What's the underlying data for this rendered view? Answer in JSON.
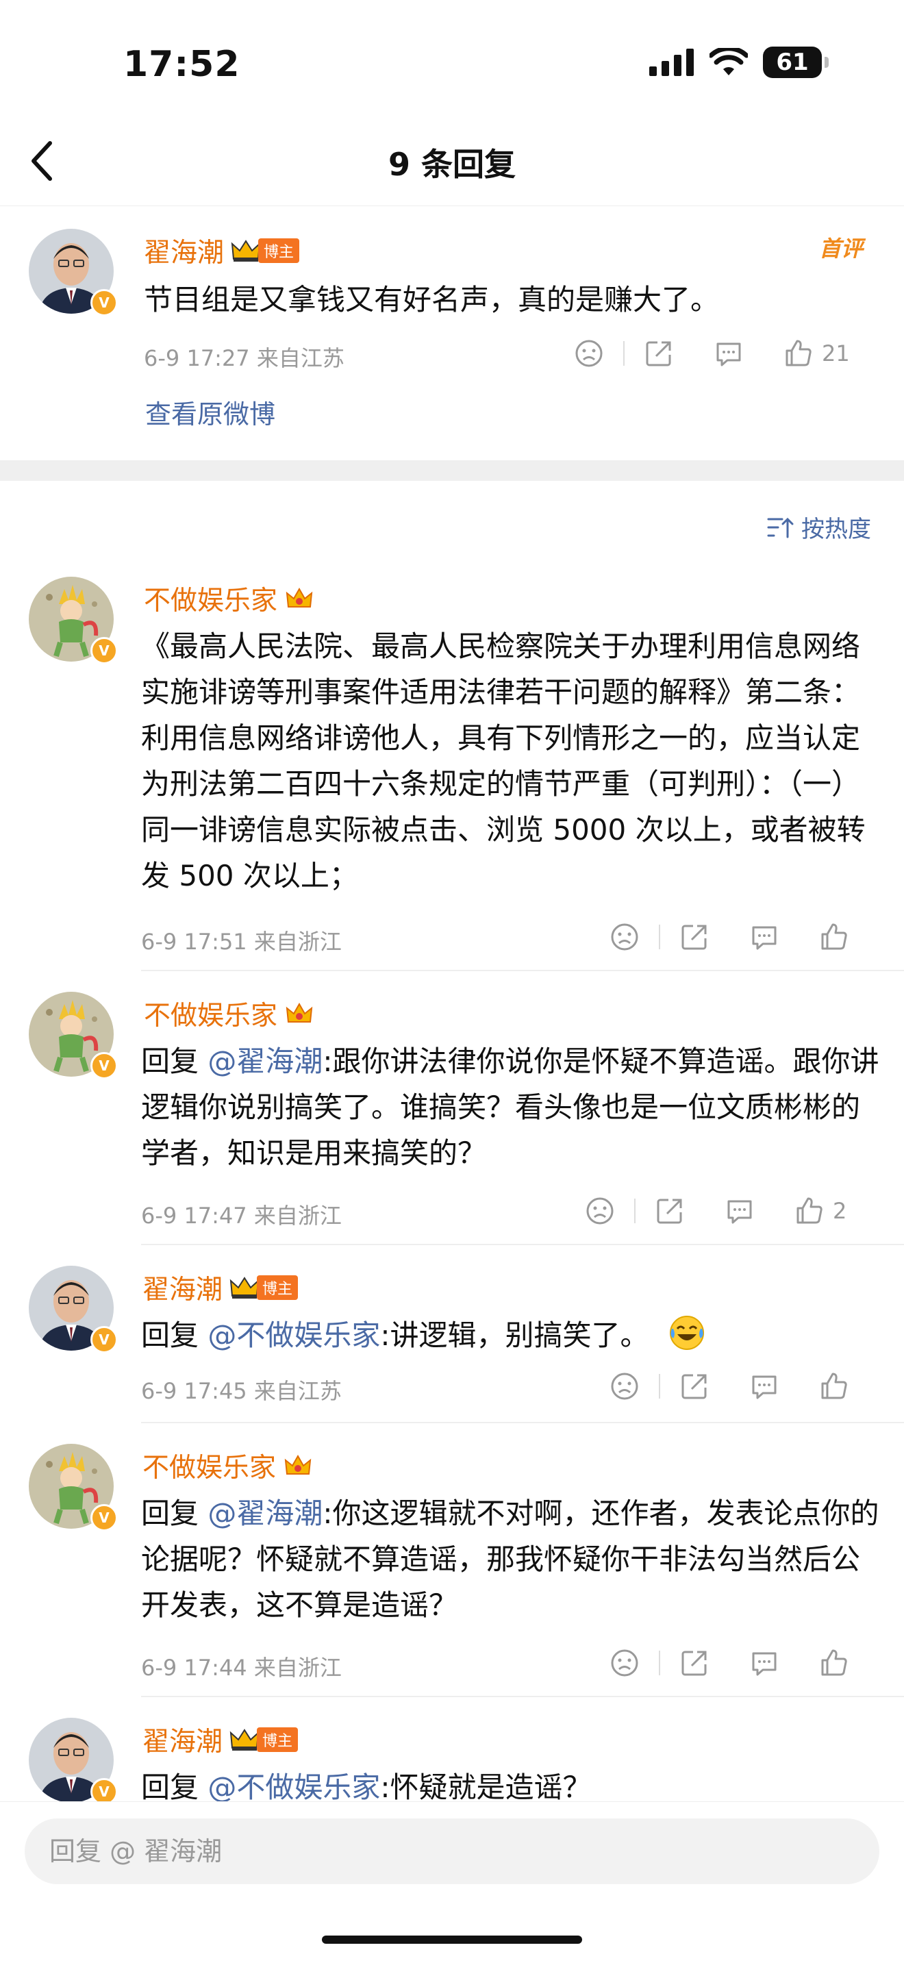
{
  "status": {
    "time": "17:52",
    "battery": "61"
  },
  "nav": {
    "title": "9 条回复"
  },
  "root": {
    "user": "翟海潮",
    "role_tag": "博主",
    "first_label": "首评",
    "text": "节目组是又拿钱又有好名声，真的是赚大了。",
    "meta": "6-9 17:27  来自江苏",
    "likes": "21",
    "view_original": "查看原微博"
  },
  "sort_label": "按热度",
  "replies": [
    {
      "user": "不做娱乐家",
      "prefix": "",
      "mention": "",
      "text": "《最高人民法院、最高人民检察院关于办理利用信息网络实施诽谤等刑事案件适用法律若干问题的解释》第二条：  利用信息网络诽谤他人，具有下列情形之一的，应当认定为刑法第二百四十六条规定的情节严重（可判刑）：（一）同一诽谤信息实际被点击、浏览 5000 次以上，或者被转发 500 次以上；",
      "meta": "6-9 17:51  来自浙江",
      "likes": ""
    },
    {
      "user": "不做娱乐家",
      "prefix": "回复 ",
      "mention": "@翟海潮",
      "text": ":跟你讲法律你说你是怀疑不算造谣。跟你讲逻辑你说别搞笑了。谁搞笑？看头像也是一位文质彬彬的学者，知识是用来搞笑的？",
      "meta": "6-9 17:47  来自浙江",
      "likes": "2"
    },
    {
      "user": "翟海潮",
      "role_tag": "博主",
      "prefix": "回复 ",
      "mention": "@不做娱乐家",
      "text": ":讲逻辑，别搞笑了。",
      "meta": "6-9 17:45  来自江苏",
      "likes": ""
    },
    {
      "user": "不做娱乐家",
      "prefix": "回复 ",
      "mention": "@翟海潮",
      "text": ":你这逻辑就不对啊，还作者，发表论点你的论据呢？怀疑就不算造谣，那我怀疑你干非法勾当然后公开发表，这不算是造谣？",
      "meta": "6-9 17:44  来自浙江",
      "likes": ""
    },
    {
      "user": "翟海潮",
      "role_tag": "博主",
      "prefix": "回复 ",
      "mention": "@不做娱乐家",
      "text": ":怀疑就是造谣？",
      "meta": "",
      "likes": ""
    }
  ],
  "input": {
    "placeholder": "回复 @ 翟海潮"
  },
  "icons": {
    "back": "chevron-left-icon",
    "signal": "signal-icon",
    "wifi": "wifi-icon",
    "dislike": "frown-icon",
    "share": "share-icon",
    "comment": "comment-icon",
    "like": "thumbs-up-icon",
    "sort": "sort-icon",
    "crown": "crown-icon",
    "laugh_cry": "laugh-cry-emoji"
  },
  "colors": {
    "username": "#e8720c",
    "mention": "#4a6aa5",
    "tag": "#f47321"
  }
}
